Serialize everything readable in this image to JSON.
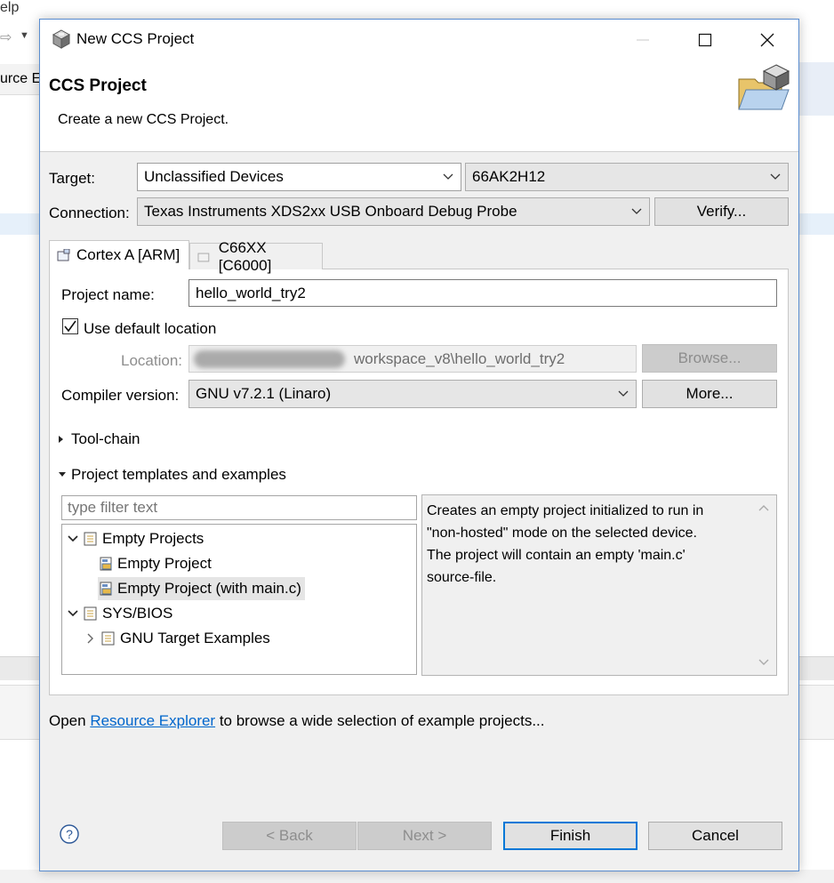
{
  "background": {
    "menu_fragment": "elp",
    "tab_fragment": "urce E"
  },
  "dialog": {
    "title": "New CCS Project"
  },
  "header": {
    "title": "CCS Project",
    "description": "Create a new CCS Project."
  },
  "target": {
    "label": "Target:",
    "family_value": "Unclassified Devices",
    "device_value": "66AK2H12"
  },
  "connection": {
    "label": "Connection:",
    "value": "Texas Instruments XDS2xx USB Onboard Debug Probe",
    "verify_label": "Verify..."
  },
  "tabs": [
    {
      "label": "Cortex A [ARM]",
      "selected": true
    },
    {
      "label": "C66XX [C6000]",
      "selected": false
    }
  ],
  "project": {
    "name_label": "Project name:",
    "name_value": "hello_world_try2",
    "use_default_label": "Use default location",
    "use_default_checked": true,
    "location_label": "Location:",
    "location_value": "workspace_v8\\hello_world_try2",
    "browse_label": "Browse...",
    "compiler_label": "Compiler version:",
    "compiler_value": "GNU v7.2.1 (Linaro)",
    "more_label": "More..."
  },
  "sections": {
    "toolchain": "Tool-chain",
    "templates": "Project templates and examples"
  },
  "templates": {
    "filter_placeholder": "type filter text",
    "tree": {
      "empty_projects": "Empty Projects",
      "empty_project": "Empty Project",
      "empty_project_main": "Empty Project (with main.c)",
      "sysbios": "SYS/BIOS",
      "gnu_target_examples": "GNU Target Examples"
    },
    "description_lines": [
      "Creates an empty project initialized to run in",
      "\"non-hosted\" mode on the selected device.",
      "The project will contain an empty 'main.c'",
      "source-file."
    ]
  },
  "footer": {
    "prefix": "Open ",
    "link": "Resource Explorer",
    "suffix": " to browse a wide selection of example projects..."
  },
  "buttons": {
    "back": "< Back",
    "next": "Next >",
    "finish": "Finish",
    "cancel": "Cancel"
  }
}
